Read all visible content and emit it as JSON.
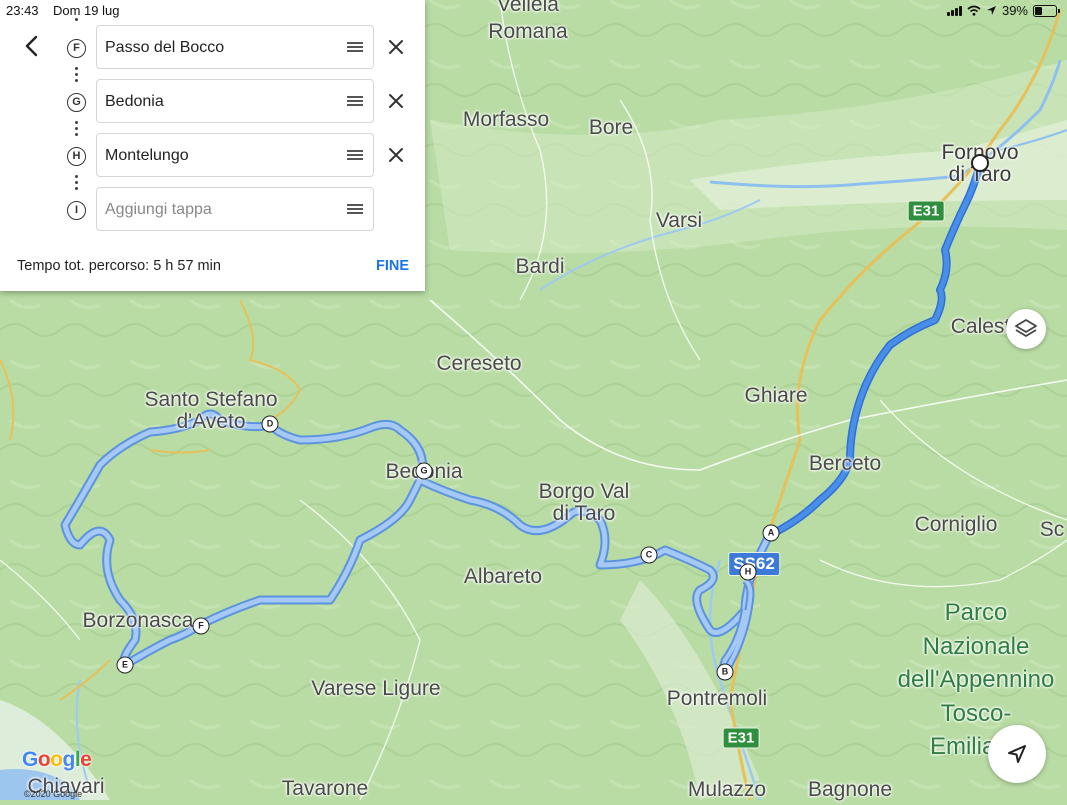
{
  "status_bar": {
    "time": "23:43",
    "date": "Dom 19 lug",
    "battery": "39%",
    "battery_level": 0.39
  },
  "directions": {
    "stops": [
      {
        "letter": "F",
        "value": "Passo del Bocco",
        "removable": true
      },
      {
        "letter": "G",
        "value": "Bedonia",
        "removable": true
      },
      {
        "letter": "H",
        "value": "Montelungo",
        "removable": true
      },
      {
        "letter": "I",
        "value": "",
        "placeholder": "Aggiungi tappa",
        "removable": false
      }
    ],
    "total_time": "Tempo tot. percorso: 5 h 57 min",
    "done_label": "FINE"
  },
  "map": {
    "places": [
      {
        "name": "Vellela"
      },
      {
        "name": "Romana"
      },
      {
        "name": "Morfasso"
      },
      {
        "name": "Bore"
      },
      {
        "name": "Varsi"
      },
      {
        "name": "Bardi"
      },
      {
        "name": "Fornovo\ndi Taro"
      },
      {
        "name": "Calestano"
      },
      {
        "name": "Cereseto"
      },
      {
        "name": "Ghiare"
      },
      {
        "name": "Santo Stefano\nd'Aveto"
      },
      {
        "name": "Bedonia"
      },
      {
        "name": "Borgo Val\ndi Taro"
      },
      {
        "name": "Berceto"
      },
      {
        "name": "Corniglio"
      },
      {
        "name": "Sc"
      },
      {
        "name": "Albareto"
      },
      {
        "name": "Borzonasca"
      },
      {
        "name": "Varese Ligure"
      },
      {
        "name": "Pontremoli"
      },
      {
        "name": "Parco\nNazionale\ndell'Appennino\nTosco-Emiliano"
      },
      {
        "name": "Chiavari"
      },
      {
        "name": "Tavarone"
      },
      {
        "name": "Mulazzo"
      },
      {
        "name": "Bagnone"
      }
    ],
    "road_shields": [
      "E31",
      "SS62",
      "E31"
    ],
    "waypoints": [
      "A",
      "B",
      "C",
      "D",
      "E",
      "F",
      "G",
      "H"
    ],
    "colors": {
      "route": "#4a8fe7",
      "route_fill": "#a6c8f5",
      "land": "#b9dca4",
      "accent": "#1a73e8"
    }
  },
  "attribution": {
    "logo": "Google",
    "copyright": "©2020 Google"
  },
  "icons": [
    "back-arrow-icon",
    "drag-handle-icon",
    "close-icon",
    "layers-icon",
    "navigation-arrow-icon",
    "signal-icon",
    "wifi-icon",
    "location-arrow-icon",
    "battery-icon"
  ]
}
